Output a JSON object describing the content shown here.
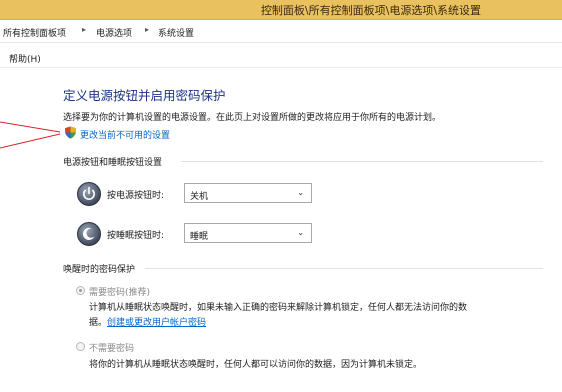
{
  "window": {
    "title": "控制面板\\所有控制面板项\\电源选项\\系统设置"
  },
  "breadcrumb": {
    "items": [
      "所有控制面板项",
      "电源选项",
      "系统设置"
    ],
    "separator": "▸"
  },
  "menu": {
    "help": "帮助(H)"
  },
  "main": {
    "title": "定义电源按钮并启用密码保护",
    "description": "选择要为你的计算机设置的电源设置。在此页上对设置所做的更改将应用于你所有的电源计划。",
    "change_link": "更改当前不可用的设置",
    "power_section": {
      "heading": "电源按钮和睡眠按钮设置",
      "rows": [
        {
          "label": "按电源按钮时:",
          "value": "关机"
        },
        {
          "label": "按睡眠按钮时:",
          "value": "睡眠"
        }
      ]
    },
    "password_section": {
      "heading": "唤醒时的密码保护",
      "require": {
        "label": "需要密码(推荐)",
        "desc_line1": "计算机从睡眠状态唤醒时，如果未输入正确的密码来解除计算机锁定，任何人都无法访问你的数",
        "desc_line2_prefix": "据。",
        "desc_link": "创建或更改用户帐户密码",
        "selected": true
      },
      "no_require": {
        "label": "不需要密码",
        "desc": "将你的计算机从睡眠状态唤醒时，任何人都可以访问你的数据，因为计算机未锁定。",
        "selected": false
      }
    }
  },
  "colors": {
    "titlebar": "#e9c15f",
    "title_text": "#1e3287",
    "link": "#0066cc",
    "arrow": "#d9232a"
  },
  "icons": [
    "shield-icon",
    "power-button-icon",
    "sleep-button-icon",
    "chevron-down-icon"
  ]
}
